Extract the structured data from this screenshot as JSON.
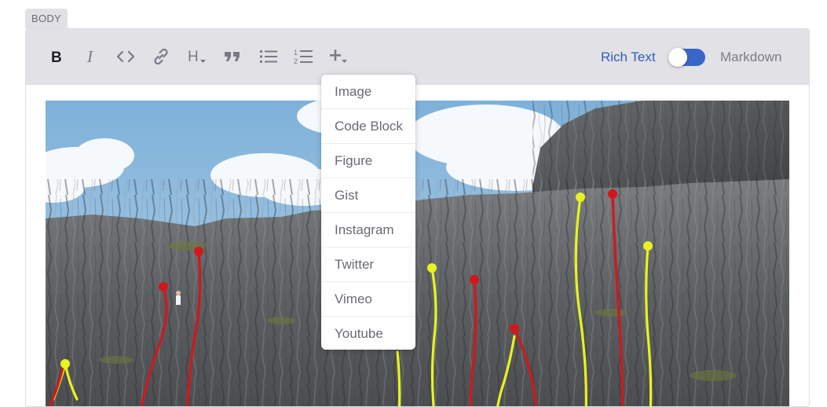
{
  "section_label": "BODY",
  "toolbar": {
    "buttons": [
      {
        "name": "bold-icon",
        "glyph": "B"
      },
      {
        "name": "italic-icon",
        "glyph": "I"
      },
      {
        "name": "code-icon",
        "glyph": "<>"
      },
      {
        "name": "link-icon",
        "glyph": "link"
      },
      {
        "name": "heading-icon",
        "glyph": "H"
      },
      {
        "name": "quote-icon",
        "glyph": "quote"
      },
      {
        "name": "bullet-list-icon",
        "glyph": "list"
      },
      {
        "name": "numbered-list-icon",
        "glyph": "ordered-list"
      },
      {
        "name": "insert-icon",
        "glyph": "+"
      }
    ],
    "rich_text_label": "Rich Text",
    "markdown_label": "Markdown",
    "toggle_on": true
  },
  "insert_menu": {
    "items": [
      "Image",
      "Code Block",
      "Figure",
      "Gist",
      "Instagram",
      "Twitter",
      "Vimeo",
      "Youtube"
    ]
  },
  "colors": {
    "toolbar_bg": "#e1e1e6",
    "accent": "#2f5fb9",
    "route_red": "#d0181c",
    "route_yellow": "#e8f320"
  }
}
